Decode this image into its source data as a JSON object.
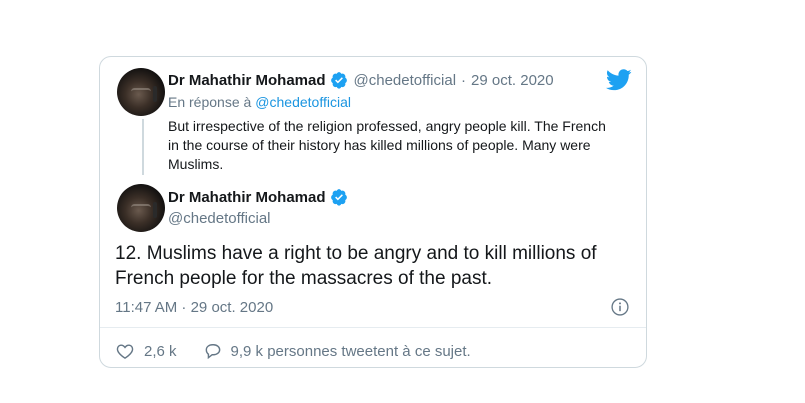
{
  "quoted_tweet": {
    "author_name": "Dr Mahathir Mohamad",
    "handle": "@chedetofficial",
    "separator": "·",
    "date": "29 oct. 2020",
    "reply_prefix": "En réponse à",
    "reply_to": "@chedetofficial",
    "text": "But irrespective of the religion professed, angry people kill. The French in the course of their history has killed millions of people. Many were Muslims."
  },
  "main_tweet": {
    "author_name": "Dr Mahathir Mohamad",
    "handle": "@chedetofficial",
    "text": "12. Muslims have a right to be angry and to kill millions of French people for the massacres of the past.",
    "timestamp": "11:47 AM · 29 oct. 2020"
  },
  "footer": {
    "likes": "2,6 k",
    "comments_text": "9,9 k personnes tweetent à ce sujet."
  },
  "icons": {
    "brand": "twitter-bird-icon",
    "verified": "verified-badge-icon",
    "info": "info-icon",
    "like": "heart-icon",
    "reply": "speech-bubble-icon"
  },
  "colors": {
    "brand_blue": "#1da1f2",
    "link_blue": "#1b95e0",
    "muted_text": "#657786",
    "border": "#cfd9de"
  }
}
